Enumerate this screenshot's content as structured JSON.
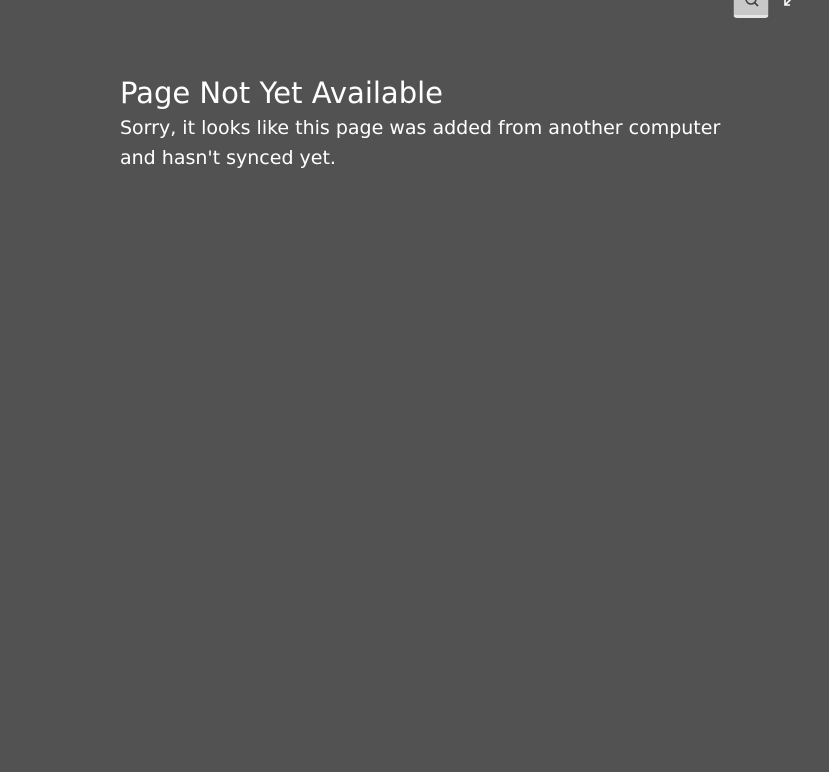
{
  "page": {
    "title": "Page Not Yet Available",
    "message": "Sorry, it looks like this page was added from another computer and hasn't synced yet."
  },
  "toolbar": {
    "search_icon": "search-icon",
    "collapse_icon": "collapse-arrow-icon"
  },
  "colors": {
    "background": "#525252",
    "text": "#ffffff",
    "button": "#c8c8c8"
  }
}
